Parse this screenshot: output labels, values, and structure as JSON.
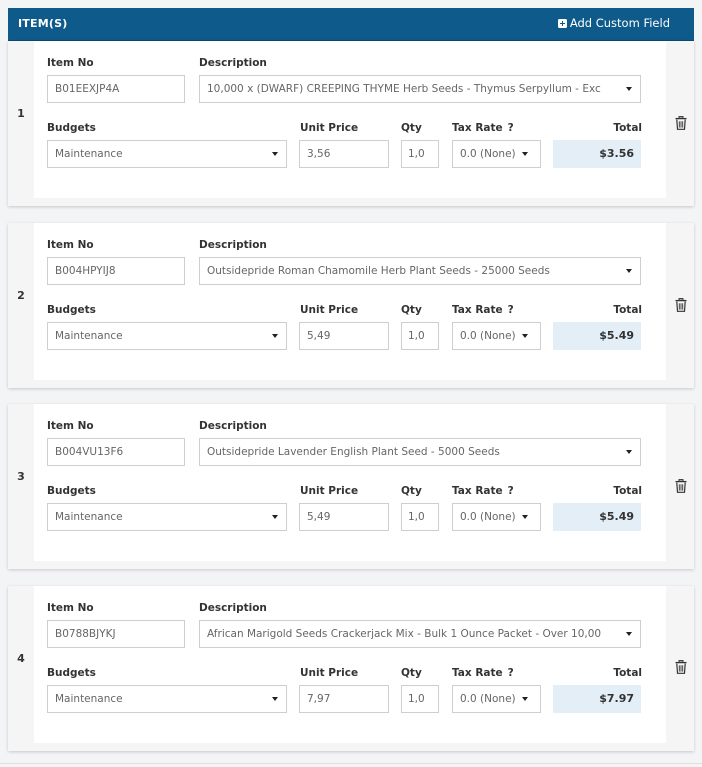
{
  "header": {
    "title": "ITEM(S)",
    "add_custom_field": "Add Custom Field"
  },
  "labels": {
    "item_no": "Item No",
    "description": "Description",
    "budgets": "Budgets",
    "unit_price": "Unit Price",
    "qty": "Qty",
    "tax_rate": "Tax Rate",
    "tax_help": "?",
    "total": "Total"
  },
  "items": [
    {
      "num": "1",
      "item_no": "B01EEXJP4A",
      "description": "10,000 x (DWARF) CREEPING THYME Herb Seeds - Thymus Serpyllum - Exc",
      "budget": "Maintenance",
      "unit_price": "3,56",
      "qty": "1,0",
      "tax_rate": "0.0 (None)",
      "total": "$3.56"
    },
    {
      "num": "2",
      "item_no": "B004HPYIJ8",
      "description": "Outsidepride Roman Chamomile Herb Plant Seeds - 25000 Seeds",
      "budget": "Maintenance",
      "unit_price": "5,49",
      "qty": "1,0",
      "tax_rate": "0.0 (None)",
      "total": "$5.49"
    },
    {
      "num": "3",
      "item_no": "B004VU13F6",
      "description": "Outsidepride Lavender English Plant Seed - 5000 Seeds",
      "budget": "Maintenance",
      "unit_price": "5,49",
      "qty": "1,0",
      "tax_rate": "0.0 (None)",
      "total": "$5.49"
    },
    {
      "num": "4",
      "item_no": "B0788BJYKJ",
      "description": "African Marigold Seeds Crackerjack Mix - Bulk 1 Ounce Packet - Over 10,00",
      "budget": "Maintenance",
      "unit_price": "7,97",
      "qty": "1,0",
      "tax_rate": "0.0 (None)",
      "total": "$7.97"
    }
  ],
  "icons": {
    "delete": "trash-icon",
    "add": "plus-square-icon",
    "dropdown": "caret-down-icon"
  },
  "colors": {
    "header_bg": "#0e5a8a",
    "total_bg": "#e3eef7"
  }
}
